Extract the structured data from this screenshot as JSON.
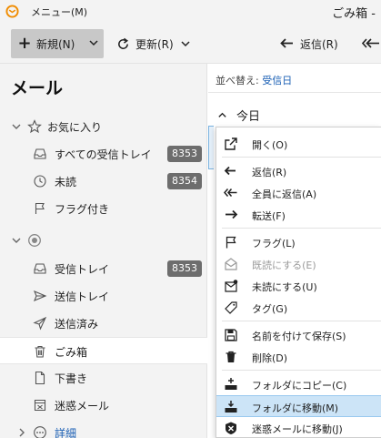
{
  "titlebar": {
    "menu_label": "メニュー(M)",
    "window_title": "ごみ箱 -"
  },
  "toolbar": {
    "new_label": "新規(N)",
    "refresh_label": "更新(R)",
    "reply_label": "返信(R)"
  },
  "nav": {
    "title": "メール",
    "favorites_label": "お気に入り",
    "items": [
      {
        "label": "すべての受信トレイ",
        "badge": "8353"
      },
      {
        "label": "未読",
        "badge": "8354"
      },
      {
        "label": "フラグ付き"
      },
      {
        "label": ""
      },
      {
        "label": "受信トレイ",
        "badge": "8353"
      },
      {
        "label": "送信トレイ"
      },
      {
        "label": "送信済み"
      },
      {
        "label": "ごみ箱"
      },
      {
        "label": "下書き"
      },
      {
        "label": "迷惑メール"
      },
      {
        "label": "詳細"
      }
    ]
  },
  "list": {
    "sort_label": "並べ替え:",
    "sort_value": "受信日",
    "group_label": "今日"
  },
  "context_menu": {
    "items": [
      {
        "label": "開く(O)",
        "icon": "open-icon"
      },
      {
        "label": "返信(R)",
        "icon": "reply-icon"
      },
      {
        "label": "全員に返信(A)",
        "icon": "reply-all-icon"
      },
      {
        "label": "転送(F)",
        "icon": "forward-icon"
      },
      {
        "label": "フラグ(L)",
        "icon": "flag-icon"
      },
      {
        "label": "既読にする(E)",
        "icon": "mark-read-icon",
        "disabled": true
      },
      {
        "label": "未読にする(U)",
        "icon": "mark-unread-icon"
      },
      {
        "label": "タグ(G)",
        "icon": "tag-icon"
      },
      {
        "label": "名前を付けて保存(S)",
        "icon": "save-icon"
      },
      {
        "label": "削除(D)",
        "icon": "delete-icon"
      },
      {
        "label": "フォルダにコピー(C)",
        "icon": "copy-to-folder-icon"
      },
      {
        "label": "フォルダに移動(M)",
        "icon": "move-to-folder-icon",
        "highlighted": true
      },
      {
        "label": "迷惑メールに移動(J)",
        "icon": "move-to-junk-icon"
      }
    ]
  },
  "colors": {
    "accent": "#1a5fb4",
    "badge": "#6d6d6d",
    "highlight": "#cce4f7"
  }
}
